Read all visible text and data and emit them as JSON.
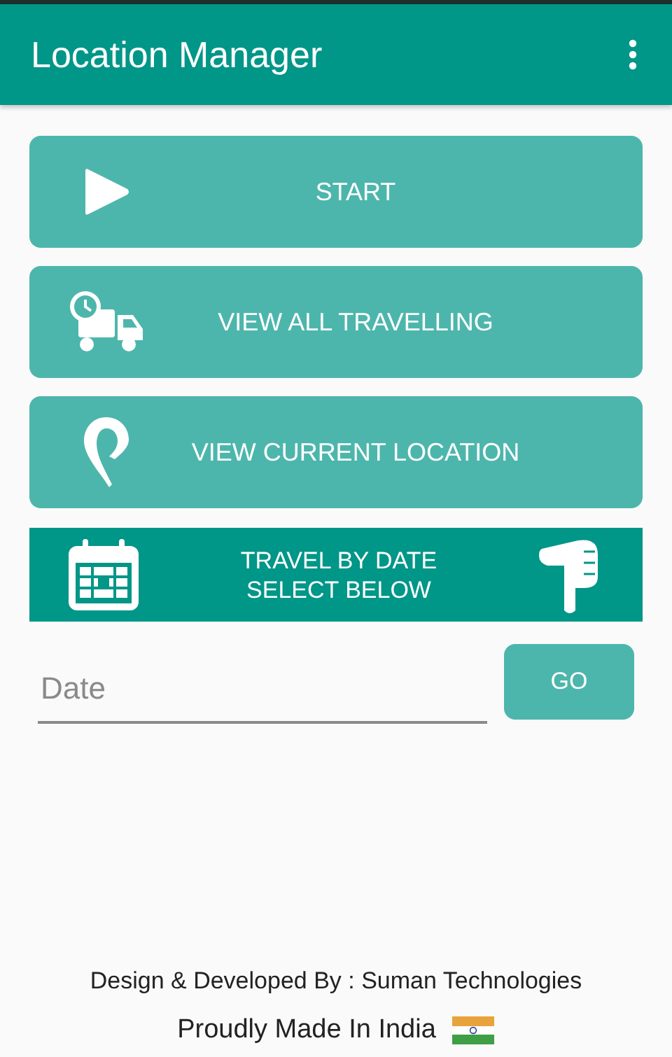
{
  "app_bar": {
    "title": "Location Manager"
  },
  "buttons": [
    {
      "label": "START",
      "kind": "start"
    },
    {
      "label": "VIEW ALL TRAVELLING",
      "kind": "travels"
    },
    {
      "label": "VIEW CURRENT LOCATION",
      "kind": "location"
    }
  ],
  "banner": {
    "lines": [
      "TRAVEL BY DATE",
      "SELECT BELOW"
    ]
  },
  "date_field": {
    "placeholder": "Date"
  },
  "go_button": {
    "label": "GO"
  },
  "footer": {
    "credit": "Design & Developed By : Suman Technologies",
    "tagline": "Proudly Made In India"
  }
}
